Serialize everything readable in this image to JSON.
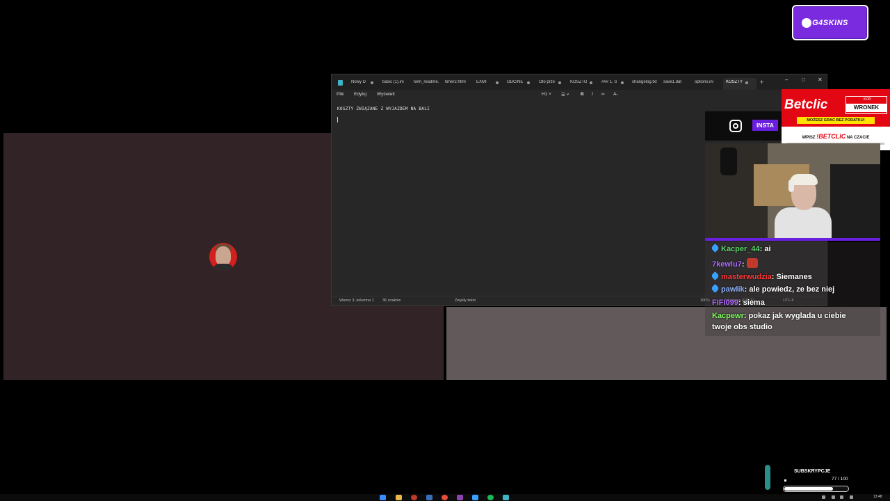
{
  "notepad": {
    "tabs": [
      {
        "label": "Nowy D",
        "dirty": true
      },
      {
        "label": "basic (1).ini",
        "dirty": false
      },
      {
        "label": "twm_readme.",
        "dirty": false
      },
      {
        "label": "timer2.html",
        "dirty": false
      },
      {
        "label": "EXMI",
        "dirty": true
      },
      {
        "label": "ODCINE",
        "dirty": true
      },
      {
        "label": "Oto prze",
        "dirty": false
      },
      {
        "label": "KOSZTO",
        "dirty": true
      },
      {
        "label": "### 1. S",
        "dirty": true
      },
      {
        "label": "changelog.txt",
        "dirty": false
      },
      {
        "label": "save1.dat",
        "dirty": false
      },
      {
        "label": "options.ini",
        "dirty": false
      },
      {
        "label": "KOSZTY",
        "dirty": true,
        "active": true
      }
    ],
    "new_tab": "+",
    "window_controls": {
      "minimize": "–",
      "maximize": "□",
      "close": "✕"
    },
    "menu": {
      "file": "Plik",
      "edit": "Edytuj",
      "view": "Wyświetl"
    },
    "toolbar": {
      "heading": "H1 ˅",
      "list": "☰ ˅",
      "bold": "B",
      "italic": "I",
      "link": "∞",
      "clear": "A̶"
    },
    "content": "KOSZTY ZWIĄZANE Z WYJAZDEM NA BALI",
    "status": {
      "position": "Wiersz 3, kolumna 1",
      "chars": "36 znaków",
      "format": "Zwykły tekst",
      "zoom": "100%",
      "line_ending": "Windows (CRLF)",
      "encoding": "UTF-8"
    }
  },
  "overlay": {
    "logo": "G4SKINS",
    "instagram_label": "INSTA",
    "betclic": {
      "brand": "Betclic",
      "kod_label": "KOD",
      "code": "WRONEK",
      "strip": "MOŻESZ GRAĆ BEZ PODATKU!",
      "wpisz": "WPISZ",
      "command": "!BETCLIC",
      "wpisz_suffix": "NA CZACIE"
    },
    "chat": [
      {
        "user": "Kacper_44",
        "color": "#5bd66b",
        "text": "ai",
        "pinned": true
      },
      {
        "user": "7kewlu7",
        "color": "#b26bff",
        "text": "",
        "emote": true
      },
      {
        "user": "masterwudzia",
        "color": "#ff3b3b",
        "text": "Siemanes",
        "pinned": true
      },
      {
        "user": "pawlik",
        "color": "#8fb4ff",
        "text": "ale powiedz, ze bez niej",
        "pinned": true
      },
      {
        "user": "FIFI099",
        "color": "#b26bff",
        "text": "siema"
      },
      {
        "user": "Kacpewr",
        "color": "#7cff5a",
        "text": "pokaz jak wyglada u ciebie twoje obs studio"
      }
    ],
    "subs": {
      "label": "SUBSKRYPCJE",
      "count": "77 / 100",
      "progress": 0.77
    }
  },
  "taskbar": {
    "clock": "13:48"
  }
}
